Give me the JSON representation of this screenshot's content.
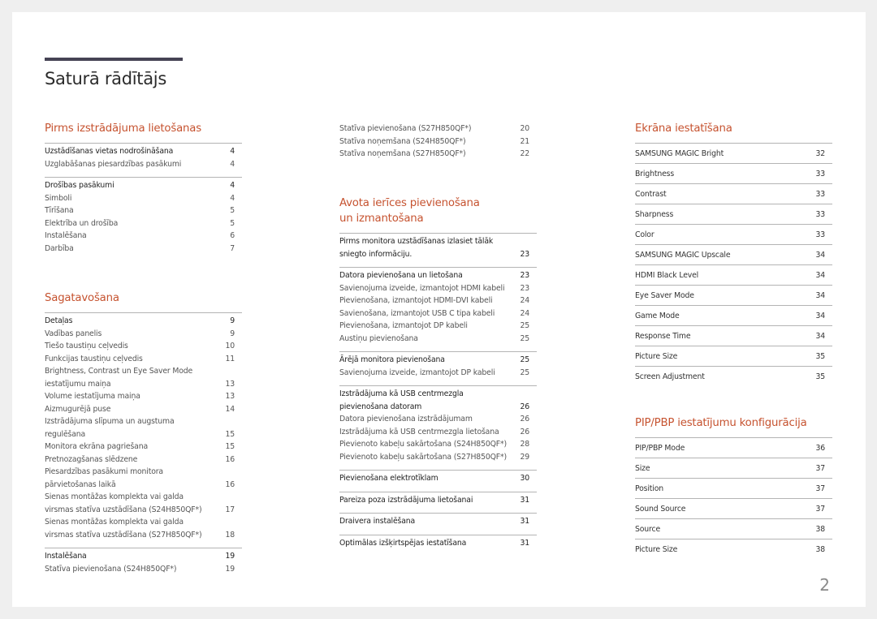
{
  "page": {
    "title": "Saturā rādītājs",
    "page_number": "2",
    "accent_color": "#c65330"
  },
  "col1": {
    "sec1": {
      "heading": "Pirms izstrādājuma lietošanas",
      "groups": [
        [
          {
            "label": "Uzstādīšanas vietas nodrošināšana",
            "page": "4"
          },
          {
            "label": "Uzglabāšanas piesardzības pasākumi",
            "page": "4"
          }
        ],
        [
          {
            "label": "Drošības pasākumi",
            "page": "4"
          },
          {
            "label": "Simboli",
            "page": "4"
          },
          {
            "label": "Tīrīšana",
            "page": "5"
          },
          {
            "label": "Elektrība un drošība",
            "page": "5"
          },
          {
            "label": "Instalēšana",
            "page": "6"
          },
          {
            "label": "Darbība",
            "page": "7"
          }
        ]
      ]
    },
    "sec2": {
      "heading": "Sagatavošana",
      "groups": [
        [
          {
            "label": "Detaļas",
            "page": "9"
          },
          {
            "label": "Vadības panelis",
            "page": "9"
          },
          {
            "label": "Tiešo taustiņu ceļvedis",
            "page": "10"
          },
          {
            "label": "Funkcijas taustiņu ceļvedis",
            "page": "11"
          },
          {
            "label": "Brightness, Contrast un Eye Saver Mode iestatījumu maiņa",
            "page": "13"
          },
          {
            "label": "Volume iestatījuma maiņa",
            "page": "13"
          },
          {
            "label": "Aizmugurējā puse",
            "page": "14"
          },
          {
            "label": "Izstrādājuma slīpuma un augstuma regulēšana",
            "page": "15"
          },
          {
            "label": "Monitora ekrāna pagriešana",
            "page": "15"
          },
          {
            "label": "Pretnozagšanas slēdzene",
            "page": "16"
          },
          {
            "label": "Piesardzības pasākumi monitora pārvietošanas laikā",
            "page": "16"
          },
          {
            "label": "Sienas montāžas komplekta vai galda virsmas statīva uzstādīšana (S24H850QF*)",
            "page": "17"
          },
          {
            "label": "Sienas montāžas komplekta vai galda virsmas statīva uzstādīšana (S27H850QF*)",
            "page": "18"
          }
        ],
        [
          {
            "label": "Instalēšana",
            "page": "19"
          },
          {
            "label": "Statīva pievienošana (S24H850QF*)",
            "page": "19"
          }
        ]
      ]
    }
  },
  "col2": {
    "continued": [
      {
        "label": "Statīva pievienošana (S27H850QF*)",
        "page": "20"
      },
      {
        "label": "Statīva noņemšana (S24H850QF*)",
        "page": "21"
      },
      {
        "label": "Statīva noņemšana (S27H850QF*)",
        "page": "22"
      }
    ],
    "sec3": {
      "heading_line1": "Avota ierīces pievienošana",
      "heading_line2": "un izmantošana",
      "groups": [
        [
          {
            "label": "Pirms monitora uzstādīšanas izlasiet tālāk sniegto informāciju.",
            "page": "23"
          }
        ],
        [
          {
            "label": "Datora pievienošana un lietošana",
            "page": "23"
          },
          {
            "label": "Savienojuma izveide, izmantojot HDMI kabeli",
            "page": "23"
          },
          {
            "label": "Pievienošana, izmantojot HDMI-DVI kabeli",
            "page": "24"
          },
          {
            "label": "Savienošana, izmantojot USB C tipa kabeli",
            "page": "24"
          },
          {
            "label": "Pievienošana, izmantojot DP kabeli",
            "page": "25"
          },
          {
            "label": "Austiņu pievienošana",
            "page": "25"
          }
        ],
        [
          {
            "label": "Ārējā monitora pievienošana",
            "page": "25"
          },
          {
            "label": "Savienojuma izveide, izmantojot DP kabeli",
            "page": "25"
          }
        ],
        [
          {
            "label": "Izstrādājuma kā USB centrmezgla pievienošana datoram",
            "page": "26"
          },
          {
            "label": "Datora pievienošana izstrādājumam",
            "page": "26"
          },
          {
            "label": "Izstrādājuma kā USB centrmezgla lietošana",
            "page": "26"
          },
          {
            "label": "Pievienoto kabeļu sakārtošana (S24H850QF*)",
            "page": "28"
          },
          {
            "label": "Pievienoto kabeļu sakārtošana (S27H850QF*)",
            "page": "29"
          }
        ],
        [
          {
            "label": "Pievienošana elektrotīklam",
            "page": "30"
          }
        ],
        [
          {
            "label": "Pareiza poza izstrādājuma lietošanai",
            "page": "31"
          }
        ],
        [
          {
            "label": "Draivera instalēšana",
            "page": "31"
          }
        ],
        [
          {
            "label": "Optimālas izšķirtspējas iestatīšana",
            "page": "31"
          }
        ]
      ]
    }
  },
  "col3": {
    "sec4": {
      "heading": "Ekrāna iestatīšana",
      "items": [
        {
          "label": "SAMSUNG MAGIC Bright",
          "page": "32"
        },
        {
          "label": "Brightness",
          "page": "33"
        },
        {
          "label": "Contrast",
          "page": "33"
        },
        {
          "label": "Sharpness",
          "page": "33"
        },
        {
          "label": "Color",
          "page": "33"
        },
        {
          "label": "SAMSUNG MAGIC Upscale",
          "page": "34"
        },
        {
          "label": "HDMI Black Level",
          "page": "34"
        },
        {
          "label": "Eye Saver Mode",
          "page": "34"
        },
        {
          "label": "Game Mode",
          "page": "34"
        },
        {
          "label": "Response Time",
          "page": "34"
        },
        {
          "label": "Picture Size",
          "page": "35"
        },
        {
          "label": "Screen Adjustment",
          "page": "35"
        }
      ]
    },
    "sec5": {
      "heading": "PIP/PBP iestatījumu konfigurācija",
      "items": [
        {
          "label": "PIP/PBP Mode",
          "page": "36"
        },
        {
          "label": "Size",
          "page": "37"
        },
        {
          "label": "Position",
          "page": "37"
        },
        {
          "label": "Sound Source",
          "page": "37"
        },
        {
          "label": "Source",
          "page": "38"
        },
        {
          "label": "Picture Size",
          "page": "38"
        }
      ]
    }
  }
}
